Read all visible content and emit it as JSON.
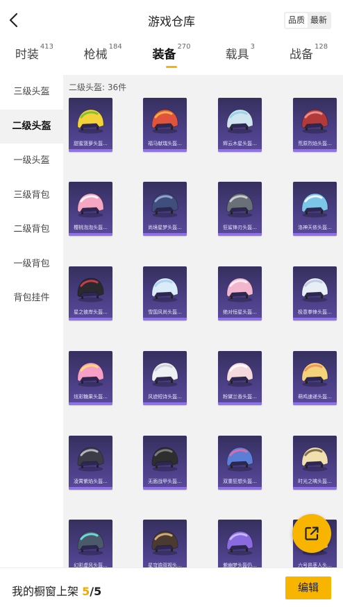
{
  "header": {
    "title": "游戏仓库",
    "sort": {
      "quality": "品质",
      "newest": "最新"
    }
  },
  "tabs": [
    {
      "label": "时装",
      "count": "413"
    },
    {
      "label": "枪械",
      "count": "184"
    },
    {
      "label": "装备",
      "count": "270"
    },
    {
      "label": "载具",
      "count": "3"
    },
    {
      "label": "战备",
      "count": "128"
    }
  ],
  "sidebar": [
    {
      "label": "三级头盔"
    },
    {
      "label": "二级头盔"
    },
    {
      "label": "一级头盔"
    },
    {
      "label": "三级背包"
    },
    {
      "label": "二级背包"
    },
    {
      "label": "一级背包"
    },
    {
      "label": "背包挂件"
    }
  ],
  "section_label": "二级头盔: 36件",
  "items": [
    {
      "name": "甜蜜菠萝头盔...",
      "color": "#f3d23a",
      "accent": "#6bbf3a"
    },
    {
      "name": "福马献瑞头盔...",
      "color": "#e0533c",
      "accent": "#f2c14b"
    },
    {
      "name": "辉云木星头盔...",
      "color": "#cfe6f0",
      "accent": "#8fd0e8"
    },
    {
      "name": "荒原烈焰头盔...",
      "color": "#b23a3a",
      "accent": "#f0a0a0"
    },
    {
      "name": "樱桃泡泡头盔...",
      "color": "#f4a6c2",
      "accent": "#ffffff"
    },
    {
      "name": "尚境星梦头盔...",
      "color": "#3f4e7a",
      "accent": "#9fb3e0"
    },
    {
      "name": "狂鲨锋刃头盔...",
      "color": "#6a7077",
      "accent": "#d8dde2"
    },
    {
      "name": "洛神天依头盔...",
      "color": "#7cc6ea",
      "accent": "#ffffff"
    },
    {
      "name": "星之彼岸头盔...",
      "color": "#2a2a2e",
      "accent": "#e04050"
    },
    {
      "name": "雪国风尚头盔...",
      "color": "#d9ecf8",
      "accent": "#a6cfee"
    },
    {
      "name": "绝对恒星头盔...",
      "color": "#f3b6cf",
      "accent": "#fff3f8"
    },
    {
      "name": "极意拳锋头盔...",
      "color": "#e8eef6",
      "accent": "#b8c6e0"
    },
    {
      "name": "炫彩糖果头盔...",
      "color": "#f6a0c8",
      "accent": "#ffe36a"
    },
    {
      "name": "风迹短诗头盔...",
      "color": "#eef1f4",
      "accent": "#c5ccd4"
    },
    {
      "name": "粉黛兰香头盔...",
      "color": "#f4d9df",
      "accent": "#ffffff"
    },
    {
      "name": "萌鸡速递头盔...",
      "color": "#f5d37a",
      "accent": "#f08a5a"
    },
    {
      "name": "凌霄紫焰头盔...",
      "color": "#3c3c48",
      "accent": "#c5c8d2"
    },
    {
      "name": "无面战甲头盔...",
      "color": "#2e2e2e",
      "accent": "#888888"
    },
    {
      "name": "双重狂想头盔...",
      "color": "#5b7fd6",
      "accent": "#f06aa0"
    },
    {
      "name": "时光之噙头盔...",
      "color": "#f0e0b0",
      "accent": "#6b5a3a"
    },
    {
      "name": "幻彩虚风头盔...",
      "color": "#4a5a6a",
      "accent": "#6ef0f0"
    },
    {
      "name": "星穹逾双视头...",
      "color": "#4a3a30",
      "accent": "#e8c080"
    },
    {
      "name": "紫幽梦头盔仍...",
      "color": "#8a6adf",
      "accent": "#d0c6ff"
    },
    {
      "name": "六号邑茎人头...",
      "color": "#f6d48c",
      "accent": "#f29a68"
    }
  ],
  "footer": {
    "label": "我的橱窗上架",
    "current": "5",
    "separator": "/",
    "total": "5",
    "edit": "编辑"
  },
  "icons": {
    "back": "chevron-left-icon",
    "share": "external-link-icon"
  },
  "colors": {
    "accent": "#f7b500",
    "card": "#4b3f86"
  }
}
